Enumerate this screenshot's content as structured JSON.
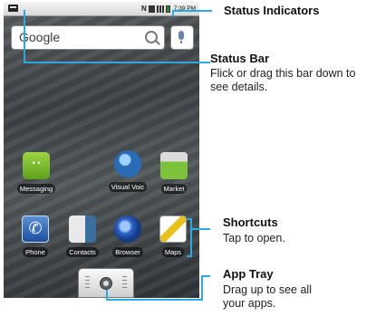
{
  "phone": {
    "status_bar": {
      "clock": "7:39 PM"
    },
    "search": {
      "logo_text": "Google"
    },
    "apps_row1": [
      {
        "label": "Messaging"
      },
      {
        "label": "Visual Voic"
      },
      {
        "label": "Market"
      }
    ],
    "apps_row2": [
      {
        "label": "Phone"
      },
      {
        "label": "Contacts"
      },
      {
        "label": "Browser"
      },
      {
        "label": "Maps"
      }
    ]
  },
  "callouts": {
    "status_indicators": {
      "title": "Status Indicators"
    },
    "status_bar": {
      "title": "Status Bar",
      "desc": "Flick or drag this bar down to see details."
    },
    "shortcuts": {
      "title": "Shortcuts",
      "desc": "Tap to open."
    },
    "app_tray": {
      "title": "App Tray",
      "desc": "Drag up to see all your apps."
    }
  },
  "colors": {
    "callout_line": "#29aae1"
  }
}
